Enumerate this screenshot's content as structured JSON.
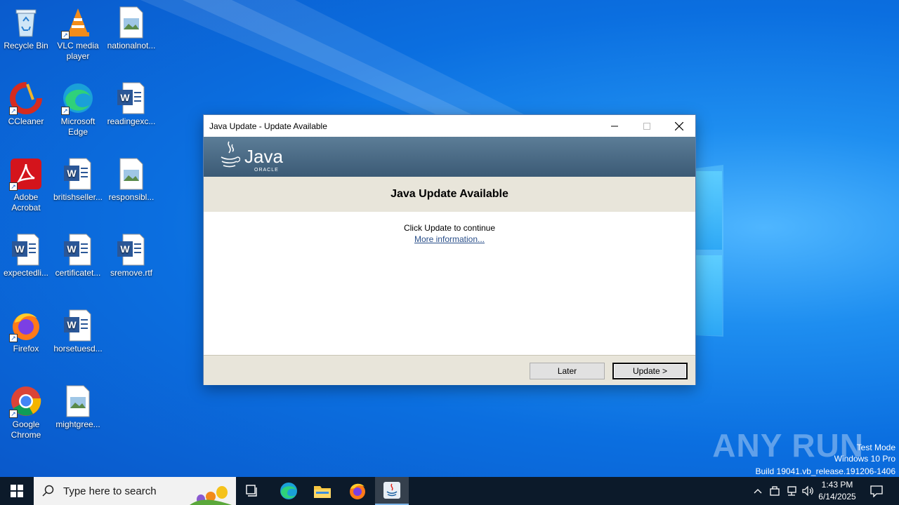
{
  "desktop": {
    "icons": [
      {
        "label": "Recycle Bin",
        "icon": "recycle-bin-icon"
      },
      {
        "label": "VLC media player",
        "icon": "vlc-icon"
      },
      {
        "label": "nationalnot...",
        "icon": "image-file-icon"
      },
      {
        "label": "CCleaner",
        "icon": "ccleaner-icon"
      },
      {
        "label": "Microsoft Edge",
        "icon": "edge-icon"
      },
      {
        "label": "readingexc...",
        "icon": "word-doc-icon"
      },
      {
        "label": "Adobe Acrobat",
        "icon": "acrobat-icon"
      },
      {
        "label": "britishseller...",
        "icon": "word-doc-icon"
      },
      {
        "label": "responsibl...",
        "icon": "image-file-icon"
      },
      {
        "label": "expectedli...",
        "icon": "word-doc-icon"
      },
      {
        "label": "certificatet...",
        "icon": "word-doc-icon"
      },
      {
        "label": "sremove.rtf",
        "icon": "word-doc-icon"
      },
      {
        "label": "Firefox",
        "icon": "firefox-icon"
      },
      {
        "label": "horsetuesd...",
        "icon": "word-doc-icon"
      },
      {
        "label": "Google Chrome",
        "icon": "chrome-icon"
      },
      {
        "label": "mightgree...",
        "icon": "image-file-icon"
      }
    ]
  },
  "window": {
    "title": "Java Update - Update Available",
    "banner_wordmark": "Java",
    "banner_sub": "ORACLE",
    "heading": "Java Update Available",
    "message": "Click Update to continue",
    "link": "More information...",
    "later_label": "Later",
    "update_label": "Update >"
  },
  "watermark": {
    "brand": "ANY RUN",
    "mode": "Test Mode",
    "edition": "Windows 10 Pro",
    "build": "Build 19041.vb_release.191206-1406"
  },
  "taskbar": {
    "search_placeholder": "Type here to search",
    "time": "1:43 PM",
    "date": "6/14/2025"
  },
  "colors": {
    "desktop_blue": "#0b6fe0",
    "taskbar": "#0c1a2a",
    "java_banner": "#4a6a86",
    "dialog_band": "#e8e5da"
  }
}
